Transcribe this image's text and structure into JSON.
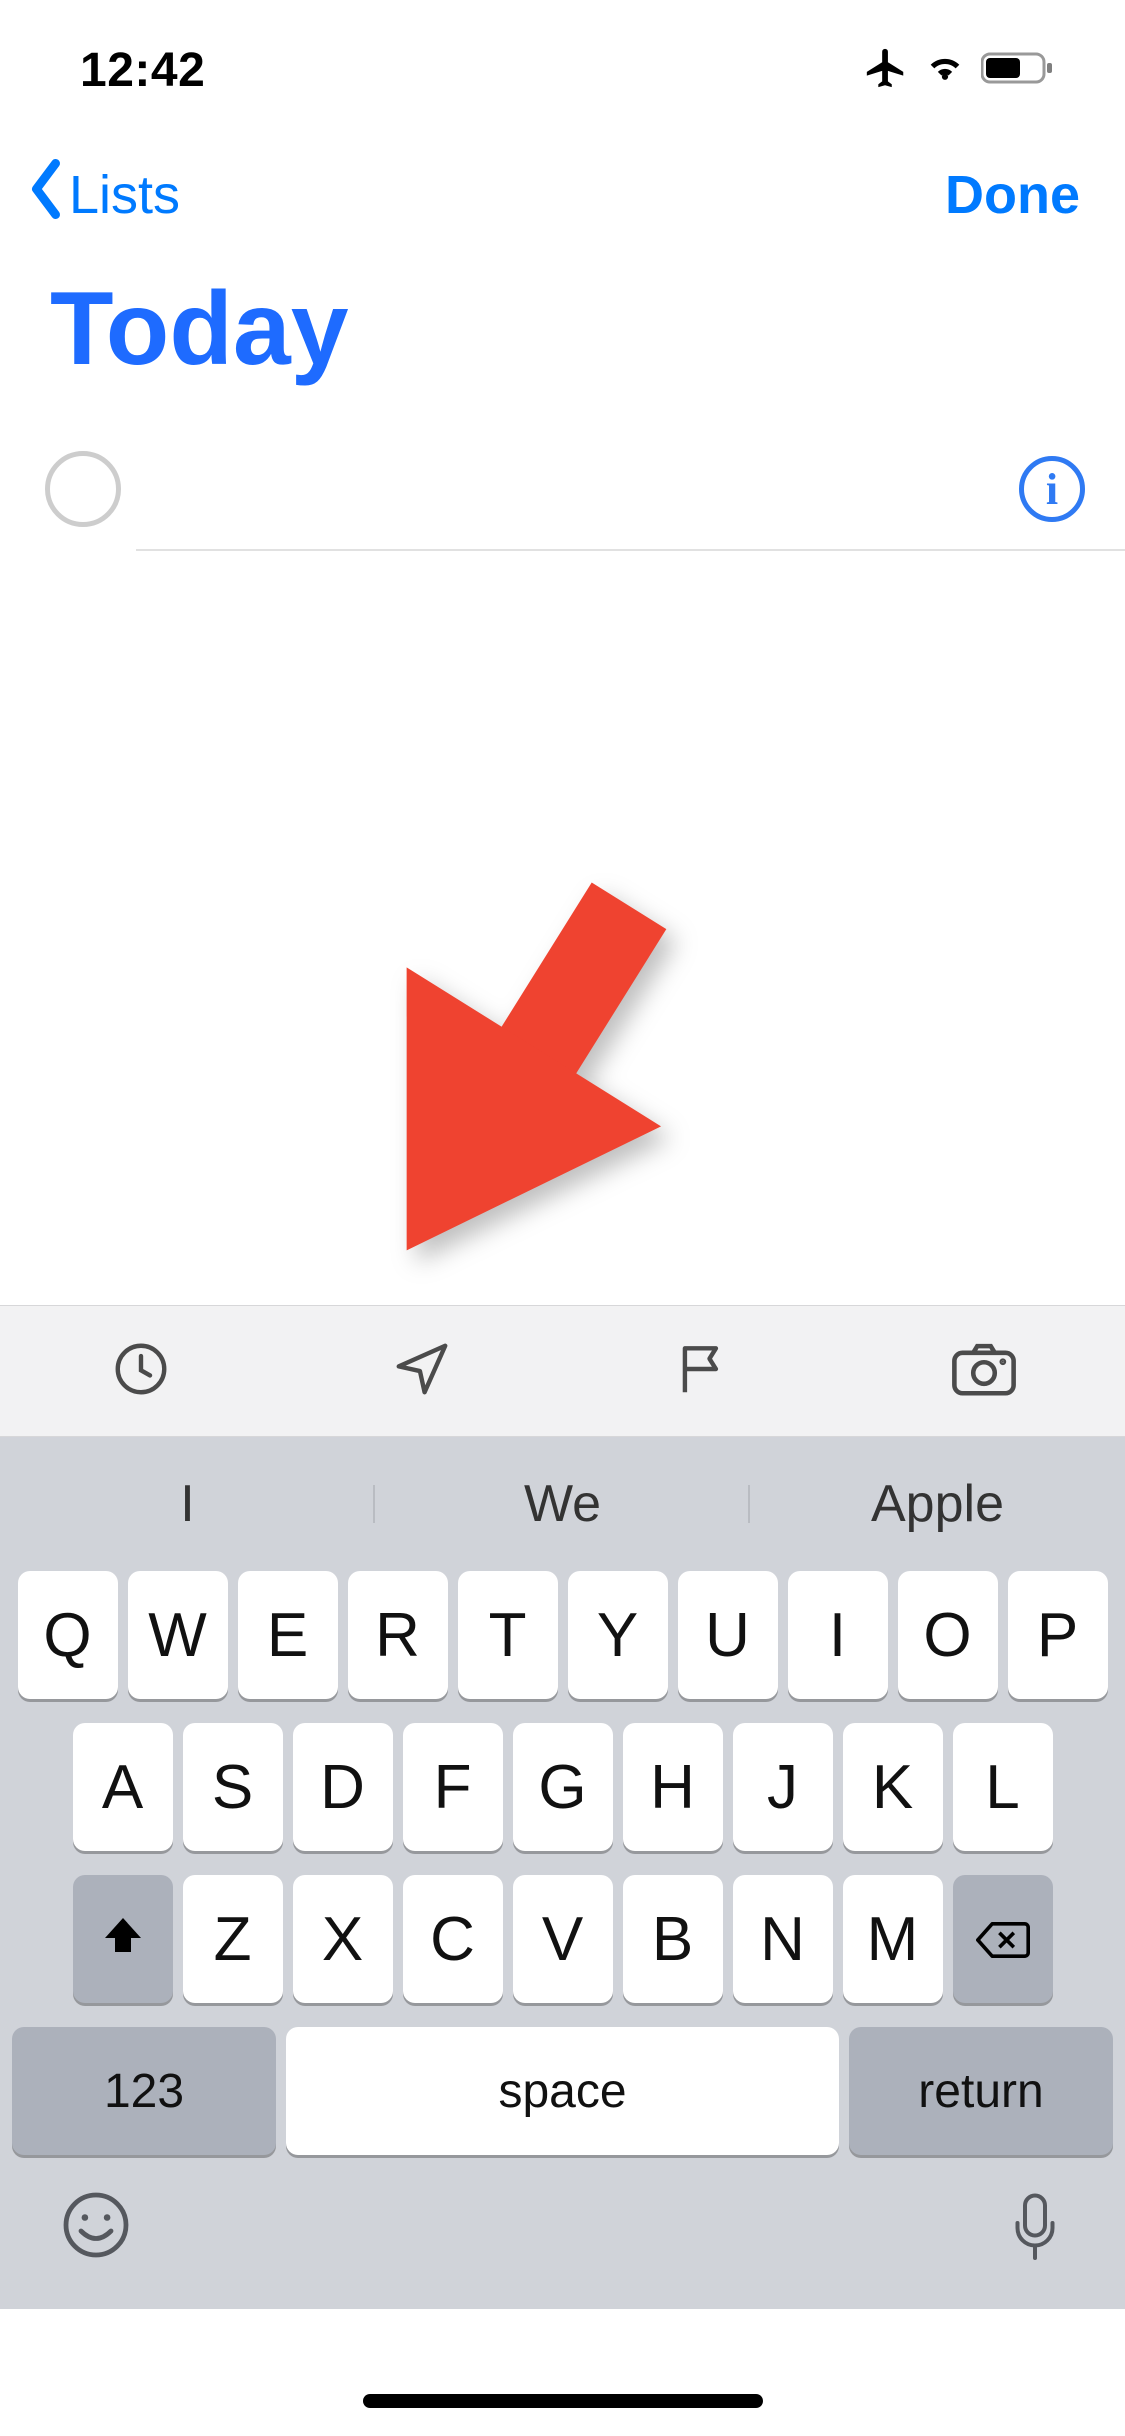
{
  "statusbar": {
    "time": "12:42"
  },
  "nav": {
    "back_label": "Lists",
    "done_label": "Done"
  },
  "title": "Today",
  "reminder": {
    "placeholder": ""
  },
  "toolbar": {
    "icons": [
      "clock-icon",
      "location-icon",
      "flag-icon",
      "camera-icon"
    ]
  },
  "suggestions": [
    "I",
    "We",
    "Apple"
  ],
  "keyboard": {
    "row1": [
      "Q",
      "W",
      "E",
      "R",
      "T",
      "Y",
      "U",
      "I",
      "O",
      "P"
    ],
    "row2": [
      "A",
      "S",
      "D",
      "F",
      "G",
      "H",
      "J",
      "K",
      "L"
    ],
    "row3": [
      "Z",
      "X",
      "C",
      "V",
      "B",
      "N",
      "M"
    ],
    "key_123": "123",
    "key_space": "space",
    "key_return": "return"
  }
}
